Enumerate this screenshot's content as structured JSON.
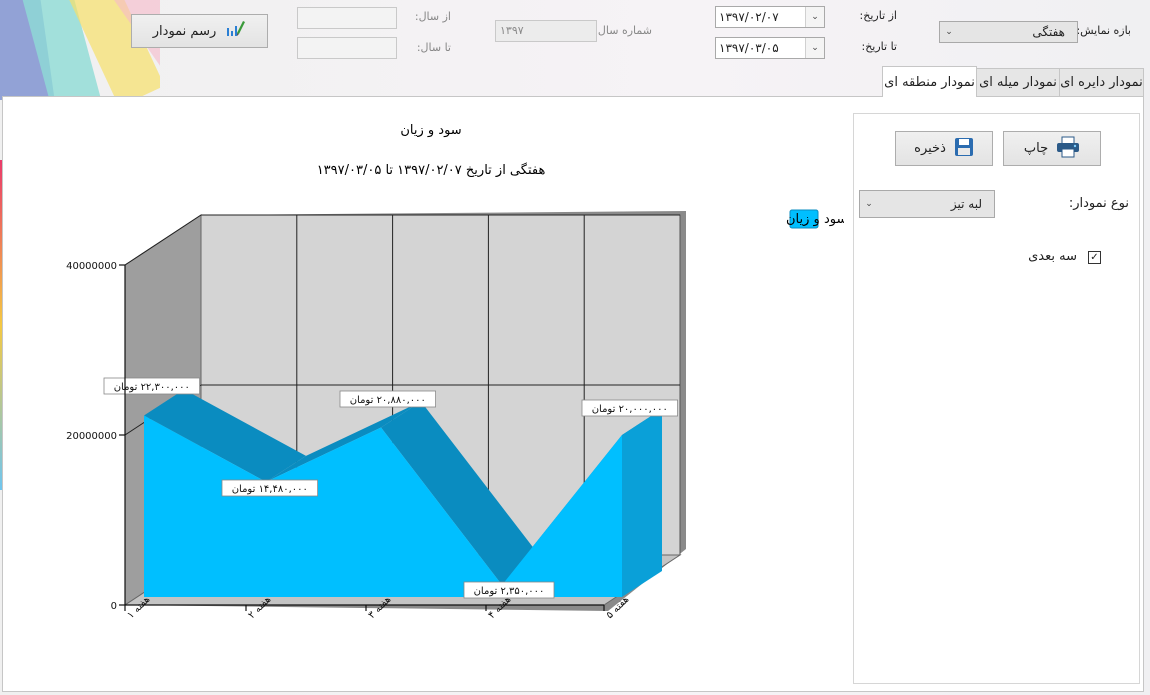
{
  "toolbar": {
    "range_label": "بازه نمایش:",
    "range_value": "هفتگی",
    "from_date_label": "از تاریخ:",
    "from_date_value": "۱۳۹۷/۰۲/۰۷",
    "to_date_label": "تا تاریخ:",
    "to_date_value": "۱۳۹۷/۰۳/۰۵",
    "year_number_label": "شماره سال:",
    "year_number_value": "۱۳۹۷",
    "from_year_label": "از سال:",
    "to_year_label": "تا سال:",
    "draw_button": "رسم نمودار"
  },
  "tabs": [
    {
      "label": "نمودار دایره ای"
    },
    {
      "label": "نمودار میله ای"
    },
    {
      "label": "نمودار منطقه ای",
      "active": true
    }
  ],
  "settings": {
    "print_button": "چاپ",
    "save_button": "ذخیره",
    "chart_type_label": "نوع نمودار:",
    "chart_type_value": "لبه تیز",
    "three_d_label": "سه بعدی",
    "three_d_checked": true
  },
  "chart_data": {
    "type": "area",
    "title": "سود و زیان",
    "subtitle": "هفتگی از تاریخ  ۱۳۹۷/۰۲/۰۷  تا  ۱۳۹۷/۰۳/۰۵",
    "three_d": true,
    "categories": [
      "هفته ۱",
      "هفته ۲",
      "هفته ۳",
      "هفته ۴",
      "هفته ۵"
    ],
    "series": [
      {
        "name": "سود و زیان",
        "color": "#00bfff",
        "values": [
          22300000,
          14480000,
          20880000,
          2350000,
          20000000
        ],
        "labels": [
          "۲۲,۳۰۰,۰۰۰ تومان",
          "۱۴,۴۸۰,۰۰۰ تومان",
          "۲۰,۸۸۰,۰۰۰ تومان",
          "۲,۳۵۰,۰۰۰ تومان",
          "۲۰,۰۰۰,۰۰۰ تومان"
        ]
      }
    ],
    "y_ticks": [
      {
        "value": 0,
        "label": "0"
      },
      {
        "value": 20000000,
        "label": "20000000"
      },
      {
        "value": 40000000,
        "label": "40000000"
      }
    ],
    "ylim": [
      0,
      40000000
    ],
    "grid": true,
    "legend_position": "top-right"
  },
  "colors": {
    "area_front": "#00bfff",
    "area_top": "#0a8cc0",
    "plot_back": "#d4d4d4",
    "wall_side": "#9e9e9e"
  }
}
